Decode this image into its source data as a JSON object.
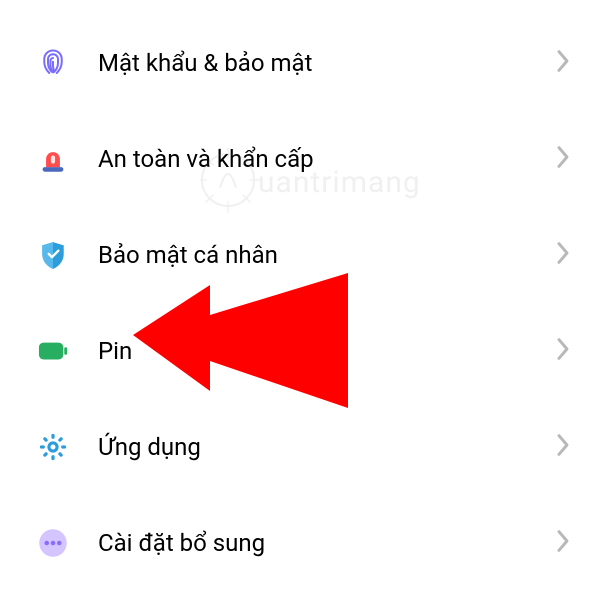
{
  "settings": {
    "items": [
      {
        "label": "Mật khẩu & bảo mật",
        "iconName": "fingerprint-icon"
      },
      {
        "label": "An toàn và khẩn cấp",
        "iconName": "emergency-icon"
      },
      {
        "label": "Bảo mật cá nhân",
        "iconName": "security-shield-icon"
      },
      {
        "label": "Pin",
        "iconName": "battery-icon"
      },
      {
        "label": "Ứng dụng",
        "iconName": "apps-gear-icon"
      },
      {
        "label": "Cài đặt bổ sung",
        "iconName": "more-icon"
      }
    ]
  },
  "colors": {
    "fingerprint": "#7a6cff",
    "emergency": "#ff4d4d",
    "emergencyBase": "#4a69bd",
    "shield": "#2d9cdb",
    "battery": "#27ae60",
    "gear": "#2d9cdb",
    "more": "#bfa8ff",
    "chevron": "#b8b8b8",
    "arrow": "#ff0000"
  },
  "watermark": {
    "text": "uantrimang"
  }
}
